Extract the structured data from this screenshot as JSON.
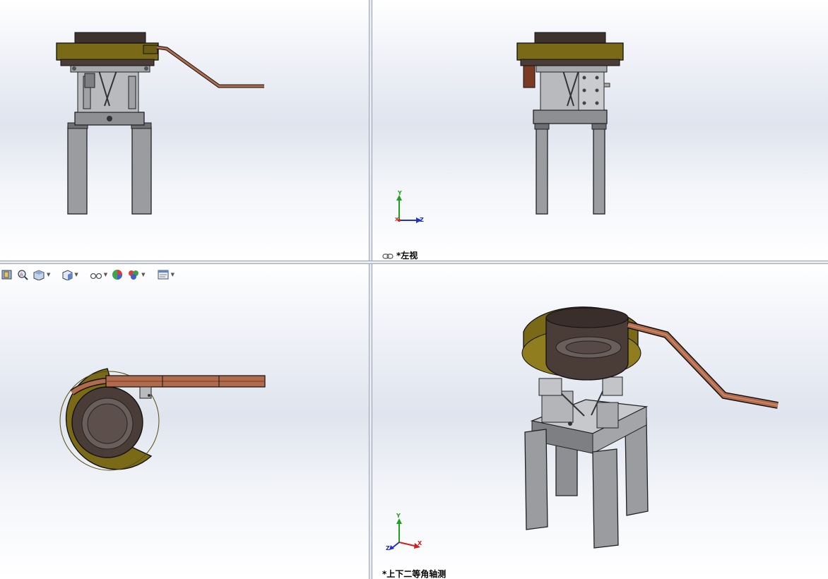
{
  "viewports": {
    "top_left": {
      "label": ""
    },
    "top_right": {
      "label": "*左视",
      "triad": {
        "up": "Y",
        "right": "Z",
        "origin": "X"
      }
    },
    "bottom_left": {
      "label": ""
    },
    "bottom_right": {
      "label": "*上下二等角轴测",
      "triad": {
        "up": "Y",
        "right": "X",
        "left": "Z"
      }
    }
  },
  "heads_up_toolbar": {
    "items": [
      {
        "name": "zoom-to-fit",
        "icon": "zoom-fit-icon"
      },
      {
        "name": "zoom-to-area",
        "icon": "zoom-area-icon"
      },
      {
        "name": "section-view",
        "icon": "section-view-icon"
      },
      {
        "name": "view-orientation",
        "icon": "view-orientation-icon"
      },
      {
        "name": "display-style",
        "icon": "display-style-icon"
      },
      {
        "name": "hide-show-items",
        "icon": "hide-show-icon"
      },
      {
        "name": "edit-appearance",
        "icon": "appearance-icon"
      },
      {
        "name": "apply-scene",
        "icon": "scene-icon"
      },
      {
        "name": "view-settings",
        "icon": "view-settings-icon"
      }
    ]
  },
  "colors": {
    "bowl_body": "#4a3c36",
    "bowl_rim": "#7a6a18",
    "track": "#b06a4c",
    "frame_grey": "#8d8f93",
    "leg_grey": "#9a9c9f",
    "axis_x": "#d02020",
    "axis_y": "#20a020",
    "axis_z": "#2030d0"
  }
}
